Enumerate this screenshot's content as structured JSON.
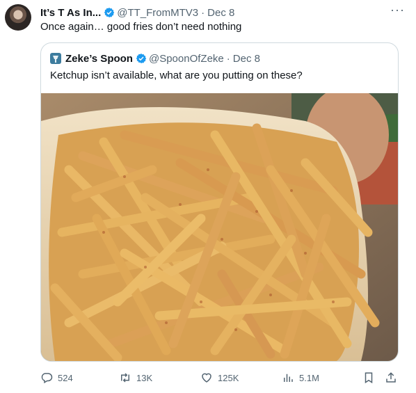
{
  "tweet": {
    "author_name": "It’s T As In...",
    "handle": "@TT_FromMTV3",
    "separator": "·",
    "date": "Dec 8",
    "text": "Once again… good fries don’t need nothing",
    "more_icon": "more-horizontal-icon"
  },
  "quote": {
    "author_name": "Zeke’s Spoon",
    "handle": "@SpoonOfZeke",
    "separator": "·",
    "date": "Dec 8",
    "text": "Ketchup isn’t available, what are you putting on these?"
  },
  "actions": {
    "replies": "524",
    "retweets": "13K",
    "likes": "125K",
    "views": "5.1M"
  },
  "colors": {
    "text": "#0f1419",
    "muted": "#536471",
    "verified": "#1d9bf0",
    "border": "#cfd9de"
  }
}
